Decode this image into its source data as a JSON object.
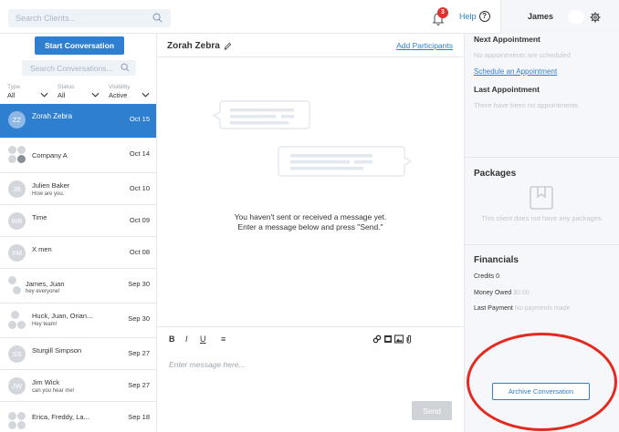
{
  "colors": {
    "accent": "#2f7fd1",
    "badge": "#e0302b",
    "annotation": "#e4291f"
  },
  "topbar": {
    "client_search_placeholder": "Search Clients...",
    "notifications_count": "3",
    "help_label": "Help",
    "help_icon_glyph": "?",
    "user_name": "James"
  },
  "left": {
    "start_button": "Start Conversation",
    "conv_search_placeholder": "Search Conversations...",
    "filters": [
      {
        "label": "Type",
        "value": "All"
      },
      {
        "label": "Status",
        "value": "All"
      },
      {
        "label": "Visibility",
        "value": "Active"
      }
    ],
    "conversations": [
      {
        "initials": "ZZ",
        "name": "Zorah Zebra",
        "sub": "",
        "date": "Oct 15",
        "active": true,
        "group": false
      },
      {
        "initials": "",
        "name": "Company A",
        "sub": "",
        "date": "Oct 14",
        "active": false,
        "group": true,
        "group_badge": "+1"
      },
      {
        "initials": "JB",
        "name": "Julien Baker",
        "sub": "How are you.",
        "date": "Oct 10",
        "active": false,
        "group": false
      },
      {
        "initials": "WB",
        "name": "Time",
        "sub": "",
        "date": "Oct 09",
        "active": false,
        "group": false
      },
      {
        "initials": "XM",
        "name": "X men",
        "sub": "",
        "date": "Oct 08",
        "active": false,
        "group": false
      },
      {
        "initials": "",
        "name": "James, Juan",
        "sub": "hey everyone!",
        "date": "Sep 30",
        "active": false,
        "group": true
      },
      {
        "initials": "",
        "name": "Huck, Juan, Orian...",
        "sub": "Hey team!",
        "date": "Sep 30",
        "active": false,
        "group": true
      },
      {
        "initials": "SS",
        "name": "Sturgill Simpson",
        "sub": "",
        "date": "Sep 27",
        "active": false,
        "group": false
      },
      {
        "initials": "JW",
        "name": "Jim Wick",
        "sub": "can you hear me!",
        "date": "Sep 27",
        "active": false,
        "group": false
      },
      {
        "initials": "",
        "name": "Erica, Freddy, La...",
        "sub": "",
        "date": "Sep 18",
        "active": false,
        "group": true
      }
    ]
  },
  "middle": {
    "title": "Zorah Zebra",
    "add_participants": "Add Participants",
    "empty_line1": "You haven't sent or received a message yet.",
    "empty_line2": "Enter a message below and press \"Send.\"",
    "format_buttons": [
      "B",
      "I",
      "U",
      "≡"
    ],
    "message_placeholder": "Enter message here...",
    "send_button": "Send"
  },
  "right": {
    "next_appointment_heading": "Next Appointment",
    "next_appointment_text": "No appointments are scheduled",
    "schedule_link": "Schedule an Appointment",
    "last_appointment_heading": "Last Appointment",
    "last_appointment_text": "There have been no appointments",
    "packages_heading": "Packages",
    "packages_text": "This client does not have any packages.",
    "financials_heading": "Financials",
    "credits_label": "Credits",
    "credits_value": "0",
    "money_owed_label": "Money Owed",
    "money_owed_value": "$0.00",
    "last_payment_label": "Last Payment",
    "last_payment_value": "No payments made",
    "archive_button": "Archive Conversation"
  }
}
